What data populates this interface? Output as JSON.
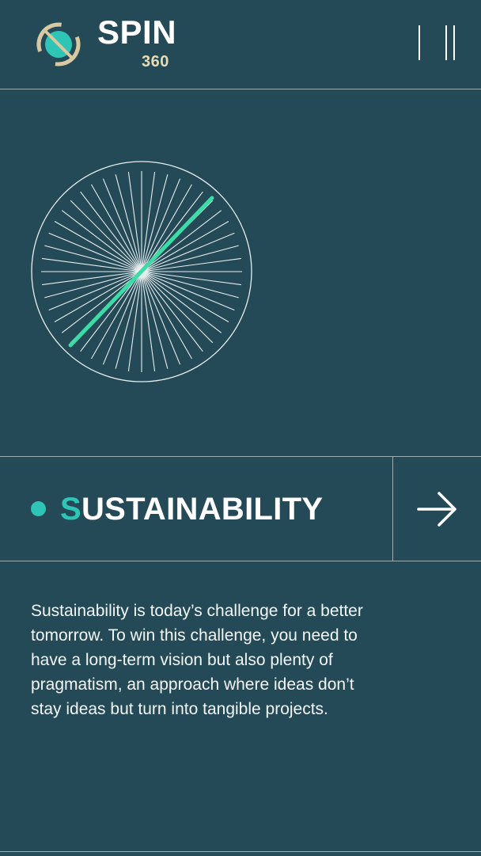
{
  "header": {
    "brand": "SPIN",
    "brand_sub": "360",
    "menu_icon": "menu-bars-icon",
    "logo_icon": "spin-logo-icon"
  },
  "section": {
    "title_first_letter": "S",
    "title_rest": "USTAINABILITY",
    "arrow_icon": "arrow-right-icon"
  },
  "description": "Sustainability is today’s challenge for a better tomorrow. To win this challenge, you need to have a long-term vision but also plenty of pragmatism, an approach where ideas don’t stay ideas but turn into tangible projects.",
  "colors": {
    "background": "#254a57",
    "accent": "#2ec5b7",
    "needle": "#3ddba6",
    "brand_sub": "#e8dcb8"
  }
}
